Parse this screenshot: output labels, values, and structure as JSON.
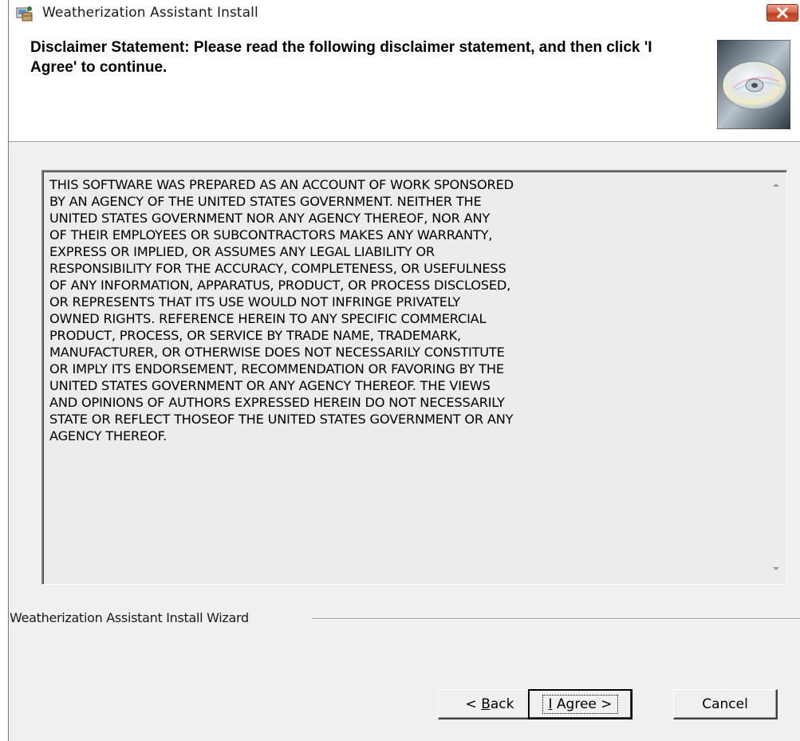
{
  "window": {
    "title": "Weatherization Assistant Install",
    "close_label": "Close"
  },
  "header": {
    "heading": "Disclaimer Statement:  Please read the following disclaimer statement, and then click 'I Agree' to continue.",
    "icon": "cd-disc-icon"
  },
  "disclaimer": {
    "text": "THIS SOFTWARE WAS PREPARED AS AN ACCOUNT OF WORK SPONSORED\nBY AN AGENCY OF THE UNITED STATES GOVERNMENT. NEITHER THE\nUNITED STATES GOVERNMENT NOR ANY AGENCY THEREOF, NOR ANY\nOF THEIR EMPLOYEES OR SUBCONTRACTORS MAKES ANY WARRANTY,\nEXPRESS OR IMPLIED, OR ASSUMES ANY LEGAL LIABILITY OR\nRESPONSIBILITY FOR THE ACCURACY, COMPLETENESS, OR USEFULNESS\nOF ANY INFORMATION, APPARATUS, PRODUCT, OR PROCESS DISCLOSED,\nOR REPRESENTS THAT ITS USE WOULD NOT INFRINGE PRIVATELY\nOWNED RIGHTS. REFERENCE HEREIN TO ANY SPECIFIC COMMERCIAL\nPRODUCT, PROCESS, OR SERVICE BY TRADE NAME, TRADEMARK,\nMANUFACTURER, OR OTHERWISE DOES NOT NECESSARILY CONSTITUTE\nOR IMPLY ITS ENDORSEMENT, RECOMMENDATION OR FAVORING BY THE\nUNITED STATES GOVERNMENT OR ANY AGENCY THEREOF. THE VIEWS\nAND OPINIONS OF AUTHORS EXPRESSED HEREIN DO NOT NECESSARILY\nSTATE OR REFLECT THOSEOF THE UNITED STATES GOVERNMENT OR ANY\nAGENCY THEREOF."
  },
  "wizard": {
    "label": "Weatherization Assistant Install Wizard"
  },
  "buttons": {
    "back_prefix": "< ",
    "back_mnemonic": "B",
    "back_rest": "ack",
    "agree_mnemonic": "I",
    "agree_rest": " Agree >",
    "cancel": "Cancel"
  },
  "colors": {
    "dialog_bg": "#f0f0f0",
    "header_bg": "#ffffff",
    "textbox_bg": "#ececec"
  }
}
